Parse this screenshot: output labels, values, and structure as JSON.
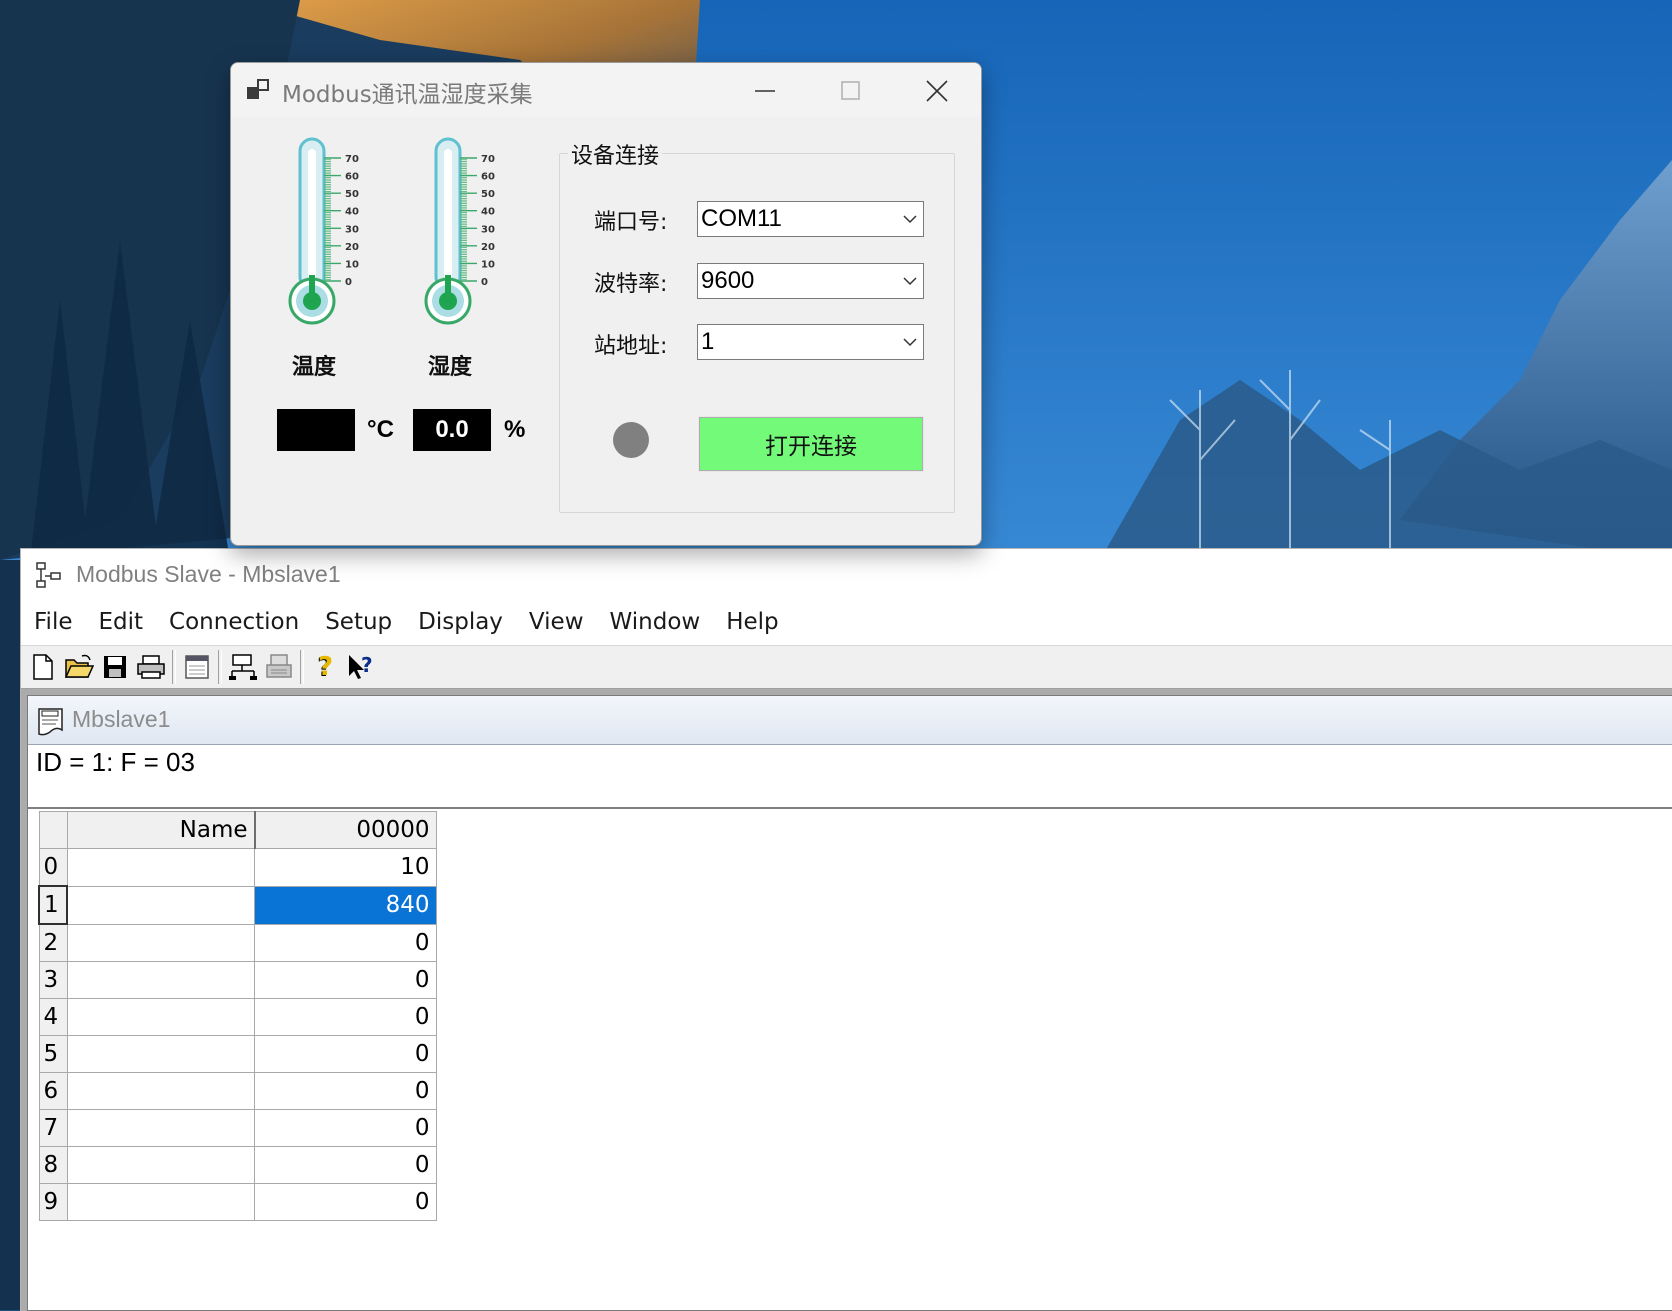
{
  "dialog": {
    "title": "Modbus通讯温湿度采集",
    "temperature": {
      "label": "温度",
      "value": "",
      "unit": "°C",
      "scale_ticks": [
        "70",
        "60",
        "50",
        "40",
        "30",
        "20",
        "10",
        "0"
      ]
    },
    "humidity": {
      "label": "湿度",
      "value": "0.0",
      "unit": "%",
      "scale_ticks": [
        "70",
        "60",
        "50",
        "40",
        "30",
        "20",
        "10",
        "0"
      ]
    },
    "connection_group": {
      "legend": "设备连接",
      "port": {
        "label": "端口号:",
        "value": "COM11"
      },
      "baud": {
        "label": "波特率:",
        "value": "9600"
      },
      "station": {
        "label": "站地址:",
        "value": "1"
      },
      "status_color": "#808080",
      "connect_button": "打开连接",
      "connect_button_color": "#73fa79"
    }
  },
  "modbus_slave": {
    "title": "Modbus Slave - Mbslave1",
    "menu": [
      "File",
      "Edit",
      "Connection",
      "Setup",
      "Display",
      "View",
      "Window",
      "Help"
    ],
    "toolbar_icons": [
      "new-icon",
      "open-icon",
      "save-icon",
      "print-icon",
      "window-icon",
      "connect-icon",
      "disconnect-icon",
      "help-icon",
      "context-help-icon"
    ],
    "child": {
      "title": "Mbslave1",
      "header": "ID = 1: F = 03",
      "columns": {
        "name": "Name",
        "address": "00000"
      },
      "rows": [
        {
          "index": "0",
          "name": "",
          "value": "10"
        },
        {
          "index": "1",
          "name": "",
          "value": "840"
        },
        {
          "index": "2",
          "name": "",
          "value": "0"
        },
        {
          "index": "3",
          "name": "",
          "value": "0"
        },
        {
          "index": "4",
          "name": "",
          "value": "0"
        },
        {
          "index": "5",
          "name": "",
          "value": "0"
        },
        {
          "index": "6",
          "name": "",
          "value": "0"
        },
        {
          "index": "7",
          "name": "",
          "value": "0"
        },
        {
          "index": "8",
          "name": "",
          "value": "0"
        },
        {
          "index": "9",
          "name": "",
          "value": "0"
        }
      ],
      "selected_row": "1",
      "selection_color": "#0a73d6"
    }
  }
}
